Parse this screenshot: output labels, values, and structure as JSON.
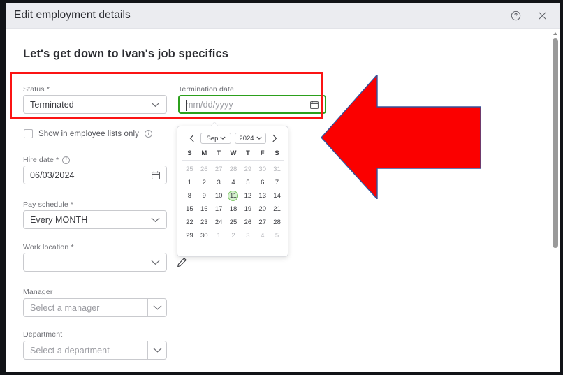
{
  "window": {
    "title": "Edit employment details",
    "help_icon": "help-circle-icon",
    "close_icon": "close-icon"
  },
  "page": {
    "heading": "Let's get down to Ivan's job specifics"
  },
  "form": {
    "status": {
      "label": "Status *",
      "value": "Terminated",
      "chevron": "chevron-down-icon"
    },
    "termination_date": {
      "label": "Termination date",
      "value": "",
      "placeholder": "mm/dd/yyyy",
      "icon": "calendar-icon",
      "focused": true,
      "focus_color": "#2ca01c"
    },
    "show_in_lists": {
      "label": "Show in employee lists only",
      "checked": false,
      "info_icon": "info-icon"
    },
    "hire_date": {
      "label": "Hire date *",
      "value": "06/03/2024",
      "icon": "calendar-icon",
      "info_icon": "info-icon"
    },
    "pay_schedule": {
      "label": "Pay schedule *",
      "value": "Every MONTH",
      "chevron": "chevron-down-icon"
    },
    "work_location": {
      "label": "Work location *",
      "value": "",
      "chevron": "chevron-down-icon",
      "edit_icon": "pencil-icon"
    },
    "manager": {
      "label": "Manager",
      "value": "",
      "placeholder": "Select a manager",
      "chevron": "chevron-down-icon"
    },
    "department": {
      "label": "Department",
      "value": "",
      "placeholder": "Select a department",
      "chevron": "chevron-down-icon"
    }
  },
  "calendar": {
    "prev_icon": "chevron-left-icon",
    "next_icon": "chevron-right-icon",
    "month": "Sep",
    "year": "2024",
    "weekdays": [
      "S",
      "M",
      "T",
      "W",
      "T",
      "F",
      "S"
    ],
    "selected_day": 11,
    "highlight_fill": "#d6f0cf",
    "highlight_border": "#76c35e",
    "weeks": [
      [
        {
          "d": "25",
          "muted": true
        },
        {
          "d": "26",
          "muted": true
        },
        {
          "d": "27",
          "muted": true
        },
        {
          "d": "28",
          "muted": true
        },
        {
          "d": "29",
          "muted": true
        },
        {
          "d": "30",
          "muted": true
        },
        {
          "d": "31",
          "muted": true
        }
      ],
      [
        {
          "d": "1"
        },
        {
          "d": "2"
        },
        {
          "d": "3"
        },
        {
          "d": "4"
        },
        {
          "d": "5"
        },
        {
          "d": "6"
        },
        {
          "d": "7"
        }
      ],
      [
        {
          "d": "8"
        },
        {
          "d": "9"
        },
        {
          "d": "10"
        },
        {
          "d": "11",
          "today": true
        },
        {
          "d": "12"
        },
        {
          "d": "13"
        },
        {
          "d": "14"
        }
      ],
      [
        {
          "d": "15"
        },
        {
          "d": "16"
        },
        {
          "d": "17"
        },
        {
          "d": "18"
        },
        {
          "d": "19"
        },
        {
          "d": "20"
        },
        {
          "d": "21"
        }
      ],
      [
        {
          "d": "22"
        },
        {
          "d": "23"
        },
        {
          "d": "24"
        },
        {
          "d": "25"
        },
        {
          "d": "26"
        },
        {
          "d": "27"
        },
        {
          "d": "28"
        }
      ],
      [
        {
          "d": "29"
        },
        {
          "d": "30"
        },
        {
          "d": "1",
          "muted": true
        },
        {
          "d": "2",
          "muted": true
        },
        {
          "d": "3",
          "muted": true
        },
        {
          "d": "4",
          "muted": true
        },
        {
          "d": "5",
          "muted": true
        }
      ]
    ]
  },
  "annotations": {
    "highlight_rect_color": "#fb1414",
    "arrow_color": "#fb0000",
    "arrow_outline_color": "#33529b",
    "arrow_direction": "left"
  },
  "scrollbar": {
    "up_arrow_icon": "scroll-up-arrow-icon"
  }
}
